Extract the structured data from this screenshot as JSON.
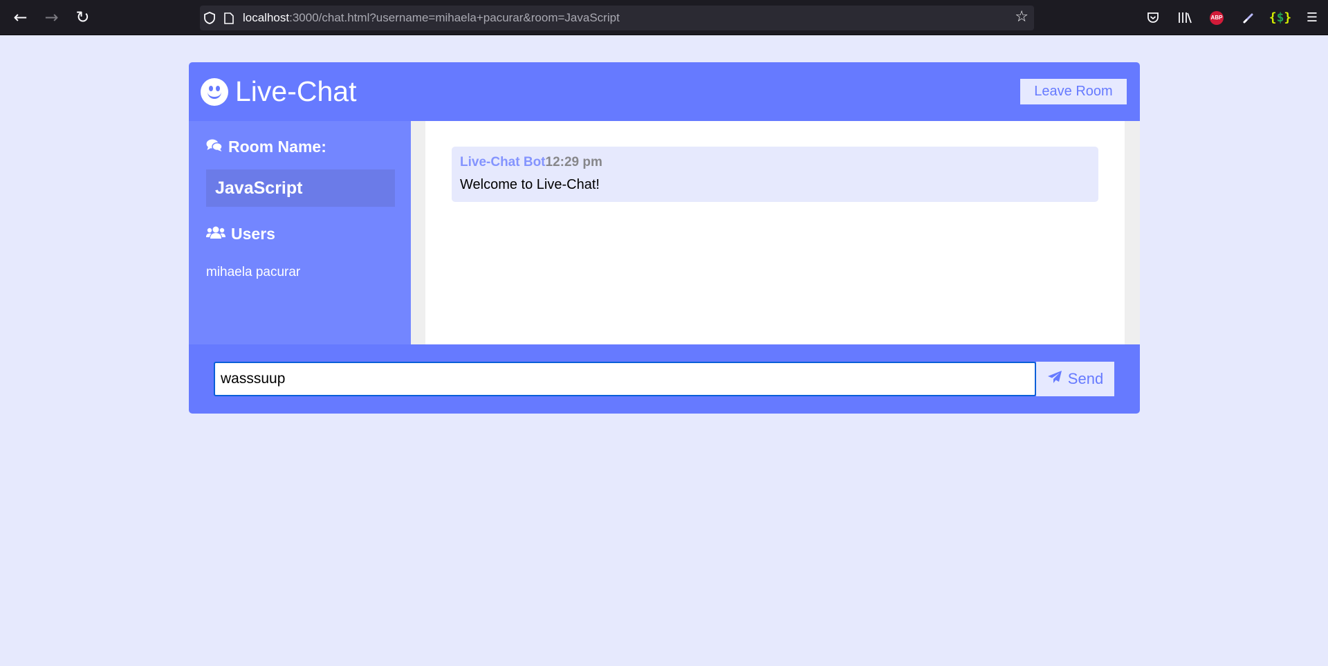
{
  "browser": {
    "back_icon": "arrow-left-icon",
    "forward_icon": "arrow-right-icon",
    "reload_icon": "reload-icon",
    "url_host": "localhost",
    "url_rest": ":3000/chat.html?username=mihaela+pacurar&room=JavaScript",
    "extensions": [
      "pocket-icon",
      "library-icon",
      "adblock-icon",
      "eyedropper-icon",
      "json-icon",
      "menu-icon"
    ],
    "abp_label": "ABP"
  },
  "header": {
    "logo_icon": "smile-icon",
    "title": "Live-Chat",
    "leave_label": "Leave Room"
  },
  "sidebar": {
    "room_heading": "Room Name:",
    "room_name": "JavaScript",
    "users_heading": "Users",
    "users": [
      "mihaela pacurar"
    ]
  },
  "messages": [
    {
      "user": "Live-Chat Bot",
      "time": "12:29 pm",
      "text": "Welcome to Live-Chat!"
    }
  ],
  "form": {
    "input_value": "wasssuup",
    "send_label": "Send"
  },
  "colors": {
    "primary": "#667aff",
    "secondary": "#7386ff",
    "light": "#e6e9ff",
    "page_bg": "#e6e9fd"
  }
}
